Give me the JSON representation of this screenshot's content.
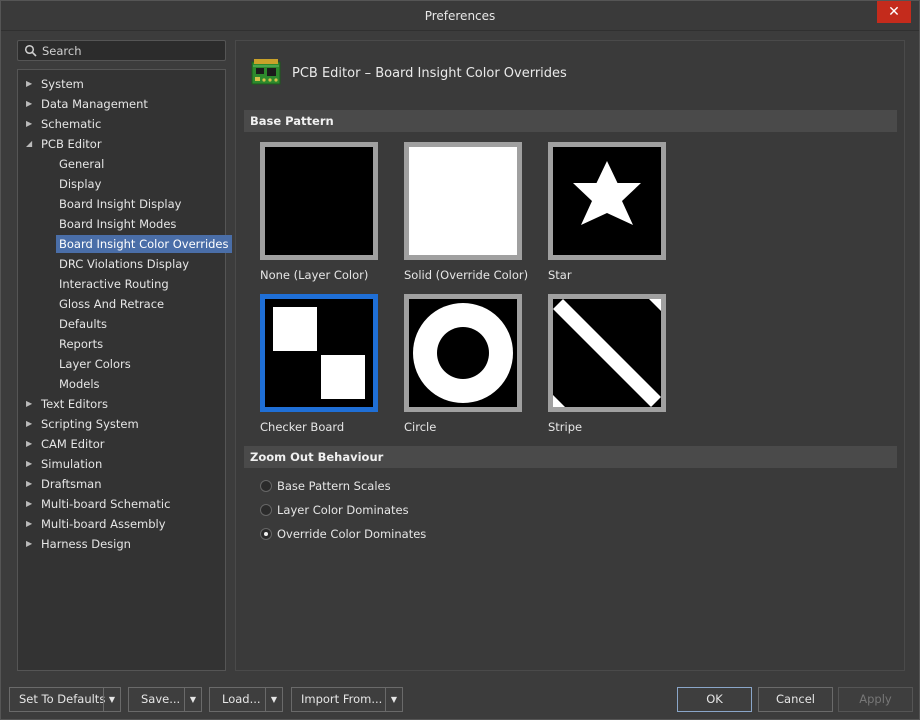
{
  "window": {
    "title": "Preferences",
    "close": "✕"
  },
  "search": {
    "placeholder": "Search"
  },
  "tree": {
    "items": [
      {
        "label": "System",
        "level": 0,
        "arrow": "▶"
      },
      {
        "label": "Data Management",
        "level": 0,
        "arrow": "▶"
      },
      {
        "label": "Schematic",
        "level": 0,
        "arrow": "▶"
      },
      {
        "label": "PCB Editor",
        "level": 0,
        "arrow": "◢"
      },
      {
        "label": "General",
        "level": 1
      },
      {
        "label": "Display",
        "level": 1
      },
      {
        "label": "Board Insight Display",
        "level": 1
      },
      {
        "label": "Board Insight Modes",
        "level": 1
      },
      {
        "label": "Board Insight Color Overrides",
        "level": 1,
        "selected": true
      },
      {
        "label": "DRC Violations Display",
        "level": 1
      },
      {
        "label": "Interactive Routing",
        "level": 1
      },
      {
        "label": "Gloss And Retrace",
        "level": 1
      },
      {
        "label": "Defaults",
        "level": 1
      },
      {
        "label": "Reports",
        "level": 1
      },
      {
        "label": "Layer Colors",
        "level": 1
      },
      {
        "label": "Models",
        "level": 1
      },
      {
        "label": "Text Editors",
        "level": 0,
        "arrow": "▶"
      },
      {
        "label": "Scripting System",
        "level": 0,
        "arrow": "▶"
      },
      {
        "label": "CAM Editor",
        "level": 0,
        "arrow": "▶"
      },
      {
        "label": "Simulation",
        "level": 0,
        "arrow": "▶"
      },
      {
        "label": "Draftsman",
        "level": 0,
        "arrow": "▶"
      },
      {
        "label": "Multi-board Schematic",
        "level": 0,
        "arrow": "▶"
      },
      {
        "label": "Multi-board Assembly",
        "level": 0,
        "arrow": "▶"
      },
      {
        "label": "Harness Design",
        "level": 0,
        "arrow": "▶"
      }
    ]
  },
  "page": {
    "title": "PCB Editor – Board Insight Color Overrides",
    "icon": "pcb-board-icon"
  },
  "base_pattern": {
    "heading": "Base Pattern",
    "patterns": [
      {
        "label": "None (Layer Color)",
        "kind": "none"
      },
      {
        "label": "Solid (Override Color)",
        "kind": "solid"
      },
      {
        "label": "Star",
        "kind": "star"
      },
      {
        "label": "Checker Board",
        "kind": "checker",
        "selected": true
      },
      {
        "label": "Circle",
        "kind": "circle"
      },
      {
        "label": "Stripe",
        "kind": "stripe"
      }
    ]
  },
  "zoom_out": {
    "heading": "Zoom Out Behaviour",
    "options": [
      {
        "label": "Base Pattern Scales",
        "checked": false
      },
      {
        "label": "Layer Color Dominates",
        "checked": false
      },
      {
        "label": "Override Color Dominates",
        "checked": true
      }
    ]
  },
  "footer": {
    "set_to_defaults": "Set To Defaults",
    "save": "Save...",
    "load": "Load...",
    "import_from": "Import From...",
    "ok": "OK",
    "cancel": "Cancel",
    "apply": "Apply",
    "dropdown_arrow": "▼"
  },
  "colors": {
    "selection": "#4a6ea8",
    "selected_pattern_border": "#1f6fd6",
    "close_button": "#c42b1c"
  }
}
